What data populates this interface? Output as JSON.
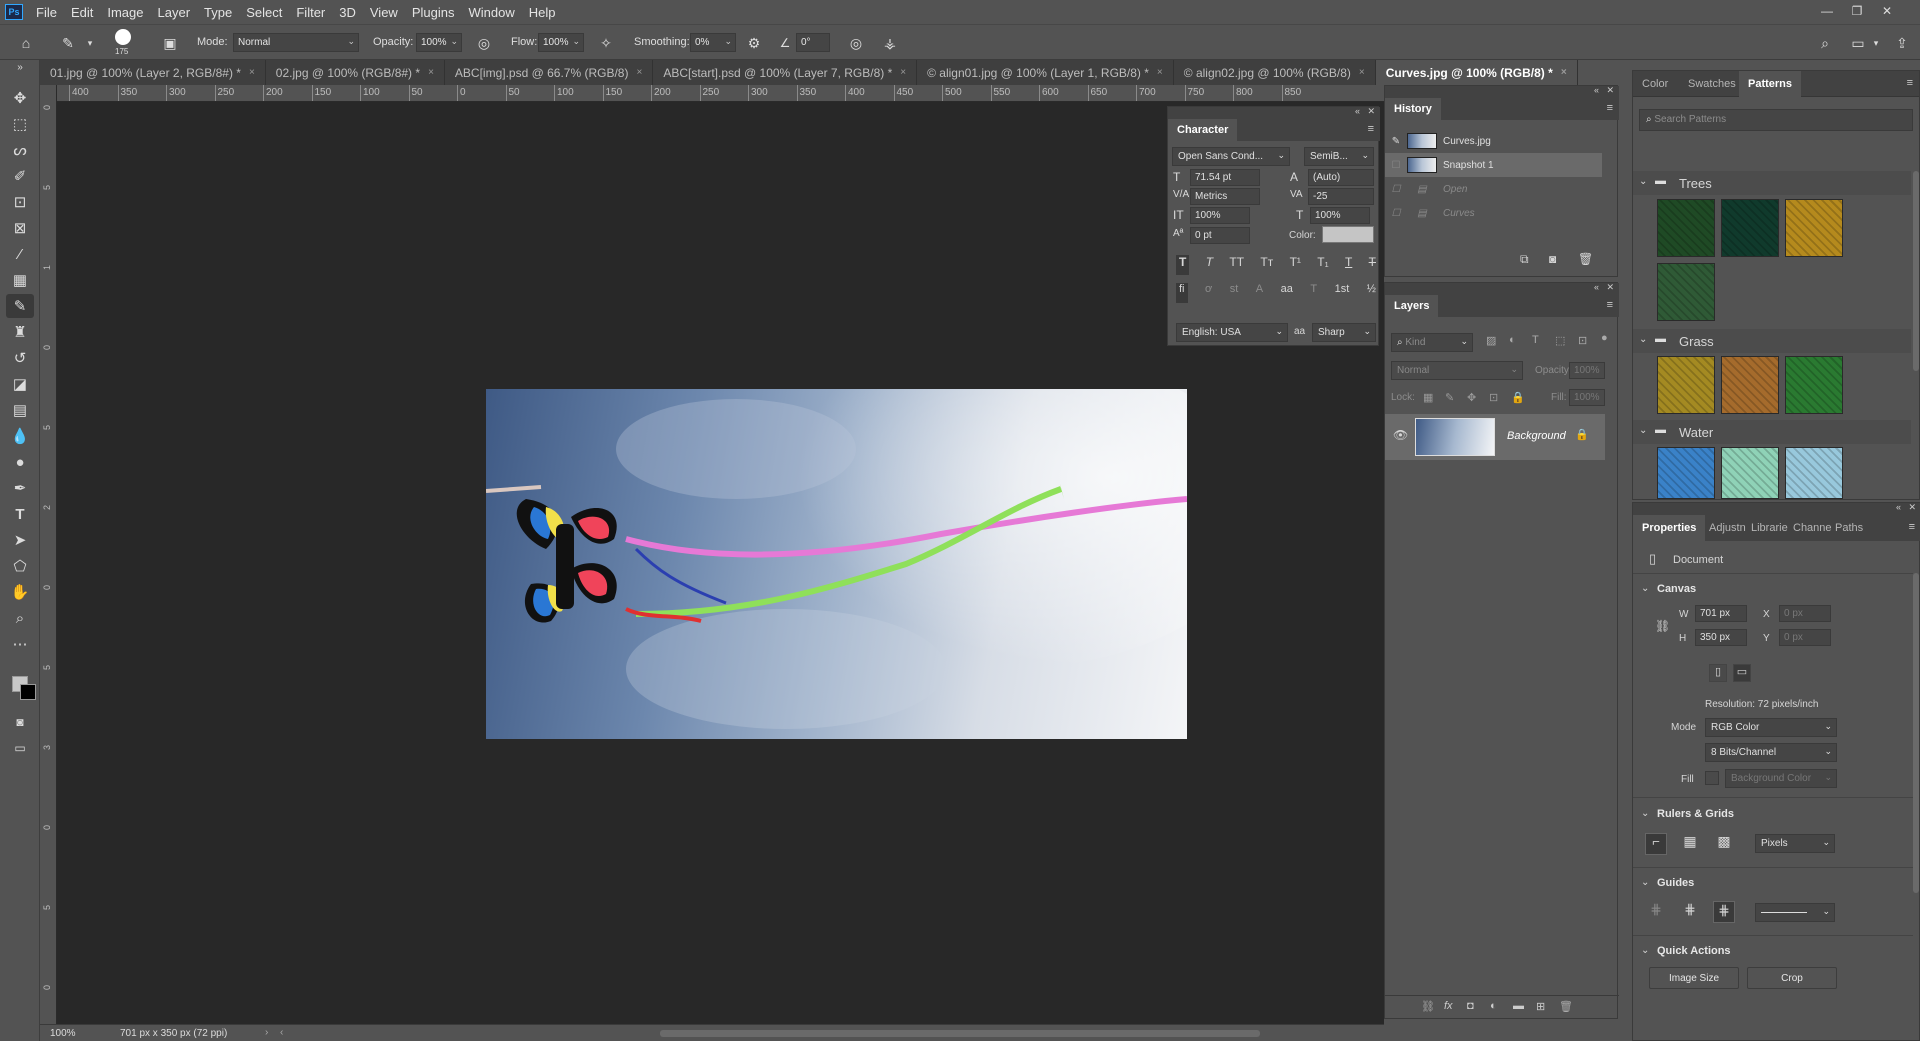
{
  "menu": [
    "File",
    "Edit",
    "Image",
    "Layer",
    "Type",
    "Select",
    "Filter",
    "3D",
    "View",
    "Plugins",
    "Window",
    "Help"
  ],
  "app_logo": "Ps",
  "options": {
    "brush_size": "175",
    "mode_label": "Mode:",
    "mode_value": "Normal",
    "opacity_label": "Opacity:",
    "opacity_value": "100%",
    "flow_label": "Flow:",
    "flow_value": "100%",
    "smoothing_label": "Smoothing:",
    "smoothing_value": "0%",
    "angle_value": "0°"
  },
  "tabs": [
    {
      "label": "01.jpg @ 100% (Layer 2, RGB/8#) *",
      "close": "×"
    },
    {
      "label": "02.jpg @ 100% (RGB/8#) *",
      "close": "×"
    },
    {
      "label": "ABC[img].psd @ 66.7% (RGB/8)",
      "close": "×"
    },
    {
      "label": "ABC[start].psd @ 100% (Layer 7, RGB/8) *",
      "close": "×"
    },
    {
      "label": "© align01.jpg @ 100% (Layer 1, RGB/8) *",
      "close": "×"
    },
    {
      "label": "© align02.jpg @ 100% (RGB/8)",
      "close": "×"
    },
    {
      "label": "Curves.jpg @ 100% (RGB/8) *",
      "close": "×"
    }
  ],
  "ruler_h": [
    "400",
    "350",
    "300",
    "250",
    "200",
    "150",
    "100",
    "50",
    "0",
    "50",
    "100",
    "150",
    "200",
    "250",
    "300",
    "350",
    "400",
    "450",
    "500",
    "550",
    "600",
    "650",
    "700",
    "750",
    "800",
    "850"
  ],
  "ruler_v": [
    "0",
    "5",
    "1",
    "0",
    "5",
    "2",
    "0",
    "5",
    "3",
    "0",
    "5",
    "0"
  ],
  "status": {
    "zoom": "100%",
    "doc": "701 px x 350 px (72 ppi)"
  },
  "character": {
    "title": "Character",
    "font": "Open Sans Cond...",
    "style": "SemiB...",
    "size": "71.54 pt",
    "leading": "(Auto)",
    "kerning": "Metrics",
    "tracking": "-25",
    "vscale": "100%",
    "hscale": "100%",
    "baseline": "0 pt",
    "color_label": "Color:",
    "language": "English: USA",
    "aa_label": "aa",
    "antialias": "Sharp",
    "type_buttons": [
      "T",
      "T",
      "TT",
      "Tт",
      "T¹",
      "T₁",
      "T",
      "T"
    ],
    "ot_buttons": [
      "fi",
      "ơ",
      "st",
      "A",
      "aa",
      "T",
      "1st",
      "½"
    ]
  },
  "history": {
    "title": "History",
    "items": [
      {
        "label": "Curves.jpg",
        "type": "snapshot"
      },
      {
        "label": "Snapshot 1",
        "type": "snapshot"
      },
      {
        "label": "Open",
        "type": "step"
      },
      {
        "label": "Curves",
        "type": "step"
      }
    ]
  },
  "layers": {
    "title": "Layers",
    "filter_placeholder": "Kind",
    "blend": "Normal",
    "opacity_label": "Opacity:",
    "opacity": "100%",
    "lock_label": "Lock:",
    "fill_label": "Fill:",
    "fill": "100%",
    "layer_name": "Background"
  },
  "patterns": {
    "tabs": [
      "Color",
      "Swatches",
      "Patterns"
    ],
    "search_placeholder": "Search Patterns",
    "groups": [
      {
        "name": "Trees",
        "swatches": [
          "#1f4a25",
          "#103a2c",
          "#b58a1d",
          "#2f5a36"
        ]
      },
      {
        "name": "Grass",
        "swatches": [
          "#a48a22",
          "#a56b2c",
          "#2a7a31"
        ]
      },
      {
        "name": "Water",
        "swatches": [
          "#3a82c8",
          "#8fd2b7",
          "#98c8dc"
        ]
      }
    ]
  },
  "properties": {
    "tabs": [
      "Properties",
      "Adjustn",
      "Librarie",
      "Channe",
      "Paths"
    ],
    "doc_label": "Document",
    "canvas_section": "Canvas",
    "w_label": "W",
    "w_value": "701 px",
    "h_label": "H",
    "h_value": "350 px",
    "x_label": "X",
    "x_value": "0 px",
    "y_label": "Y",
    "y_value": "0 px",
    "resolution": "Resolution: 72 pixels/inch",
    "mode_label": "Mode",
    "mode_value": "RGB Color",
    "bits_value": "8 Bits/Channel",
    "fill_label": "Fill",
    "fill_value": "Background Color",
    "rulers_section": "Rulers & Grids",
    "units_value": "Pixels",
    "guides_section": "Guides",
    "quick_section": "Quick Actions",
    "image_size_btn": "Image Size",
    "crop_btn": "Crop"
  }
}
